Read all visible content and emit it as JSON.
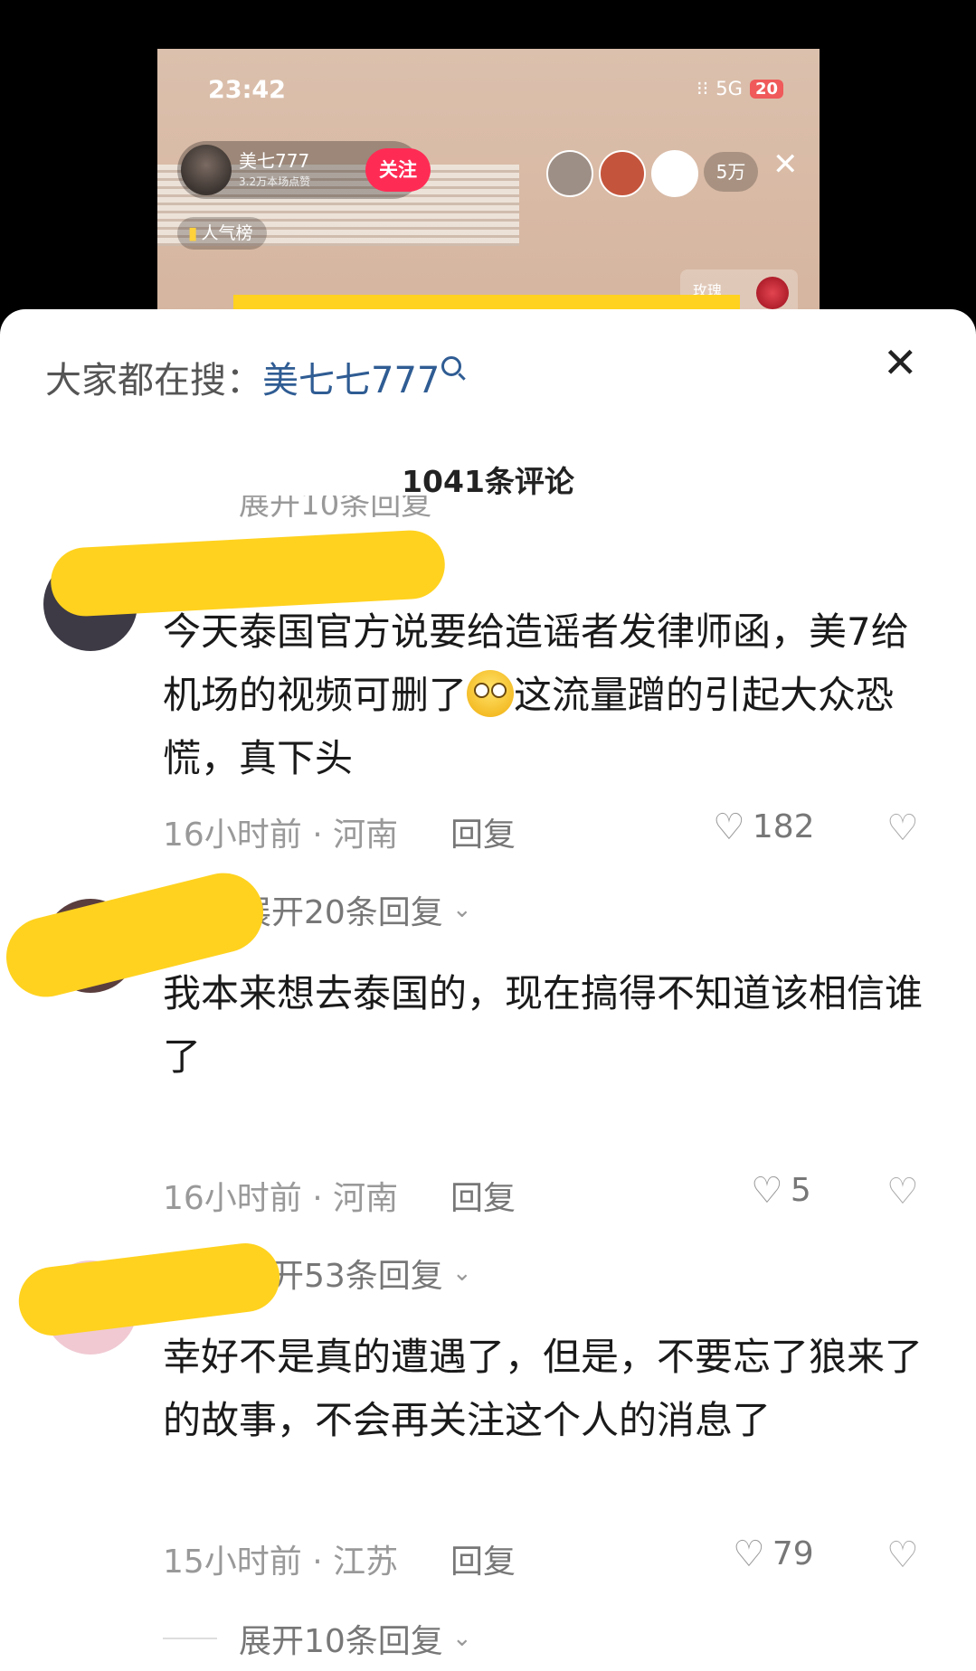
{
  "stream": {
    "time": "23:42",
    "signal": "5G",
    "battery": "20",
    "host_name": "美七777",
    "host_sub": "3.2万本场点赞",
    "follow_label": "关注",
    "rank_label": "人气榜",
    "viewer_count": "5万",
    "gift_label": "玫瑰"
  },
  "sheet": {
    "search_prefix": "大家都在搜：",
    "search_keyword": "美七七777",
    "comment_count_title": "1041条评论",
    "ghost_expand": "展开10条回复"
  },
  "comments": [
    {
      "text_part1": "今天泰国官方说要给造谣者发律师函，美7给机场的视频可删了",
      "text_part2": "这流量蹭的引起大众恐慌，真下头",
      "time_loc": "16小时前 · 河南",
      "reply": "回复",
      "likes": "182",
      "expand": "展开20条回复"
    },
    {
      "text": "我本来想去泰国的，现在搞得不知道该相信谁了",
      "time_loc": "16小时前 · 河南",
      "reply": "回复",
      "likes": "5",
      "expand": "展开53条回复"
    },
    {
      "text": "幸好不是真的遭遇了，但是，不要忘了狼来了的故事，不会再关注这个人的消息了",
      "time_loc": "15小时前 · 江苏",
      "reply": "回复",
      "likes": "79",
      "expand": "展开10条回复"
    }
  ],
  "colors": {
    "accent_follow": "#fe2c55",
    "search_keyword": "#2f5c93",
    "redaction": "#ffd21f"
  }
}
